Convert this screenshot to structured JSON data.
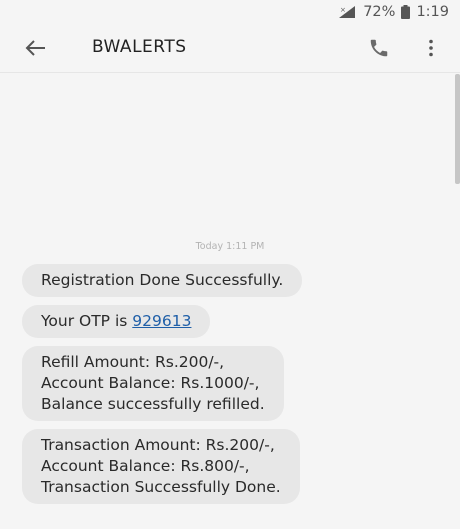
{
  "status_bar": {
    "battery_percent": "72%",
    "time": "1:19",
    "icons": [
      "signal-no-data-icon",
      "battery-icon"
    ]
  },
  "app_bar": {
    "title": "BWALERTS",
    "icons": [
      "back-arrow-icon",
      "phone-icon",
      "more-vert-icon"
    ]
  },
  "conversation": {
    "timestamp": "Today 1:11 PM",
    "messages": [
      {
        "lines": [
          "Registration Done Successfully."
        ]
      },
      {
        "prefix": "Your OTP is ",
        "link": "929613"
      },
      {
        "lines": [
          "Refill Amount: Rs.200/-,",
          "Account Balance: Rs.1000/-,",
          "Balance successfully refilled."
        ]
      },
      {
        "lines": [
          "Transaction Amount: Rs.200/-,",
          "Account Balance: Rs.800/-,",
          "Transaction Successfully Done."
        ]
      }
    ]
  },
  "colors": {
    "background": "#f5f5f5",
    "bubble": "#e7e7e7",
    "link": "#1f5fa8"
  }
}
